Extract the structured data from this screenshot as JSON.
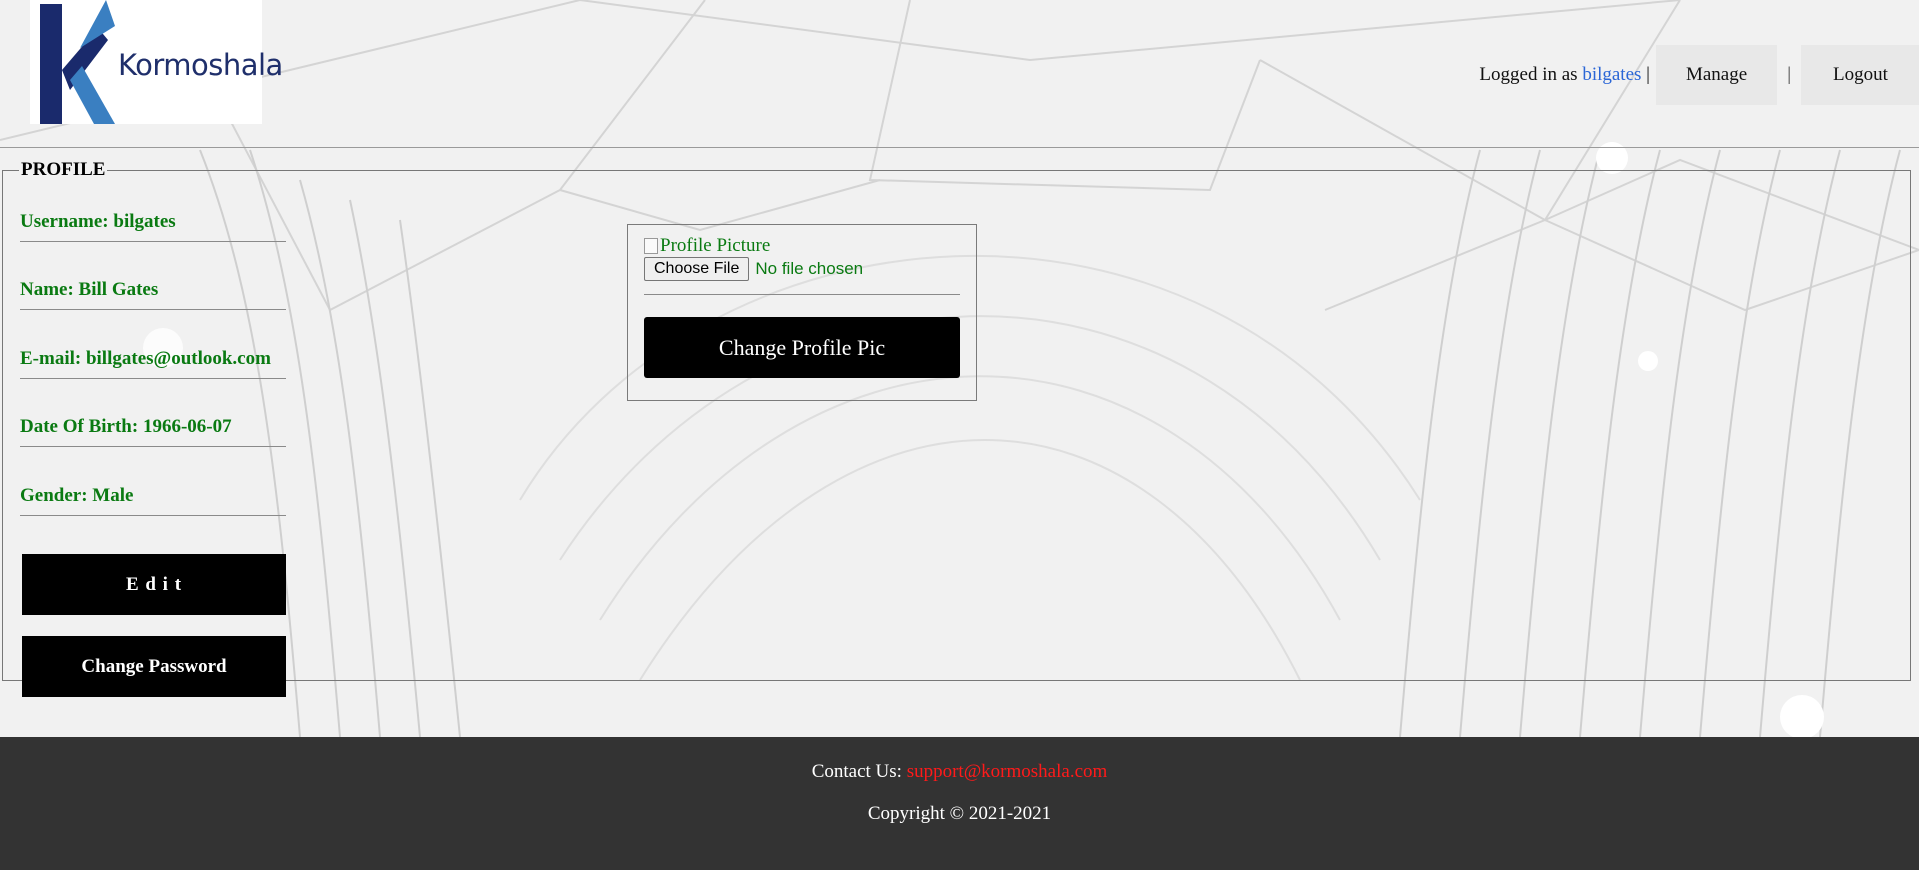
{
  "header": {
    "logo_text": "Kormoshala",
    "logged_in_prefix": "Logged in as ",
    "username": "bilgates",
    "separator": "|",
    "manage_label": "Manage",
    "logout_label": "Logout"
  },
  "profile": {
    "legend": "PROFILE",
    "fields": [
      {
        "text": "Username: bilgates"
      },
      {
        "text": "Name: Bill Gates"
      },
      {
        "text": "E-mail: billgates@outlook.com"
      },
      {
        "text": "Date Of Birth: 1966-06-07"
      },
      {
        "text": "Gender: Male"
      }
    ],
    "edit_label": "E d i t",
    "change_password_label": "Change Password"
  },
  "picture": {
    "alt_text": "Profile Picture",
    "choose_file_label": "Choose File",
    "no_file_text": "No file chosen",
    "change_pic_label": "Change Profile Pic"
  },
  "footer": {
    "contact_prefix": "Contact Us: ",
    "contact_email": "support@kormoshala.com",
    "copyright": "Copyright © 2021-2021"
  },
  "colors": {
    "field_text": "#0a7a12",
    "username_link": "#2a66d6",
    "footer_bg": "#333333",
    "footer_email": "#ff1a1a",
    "button_bg": "#000000"
  },
  "icons": [
    "logo-k-icon",
    "broken-image-icon"
  ]
}
